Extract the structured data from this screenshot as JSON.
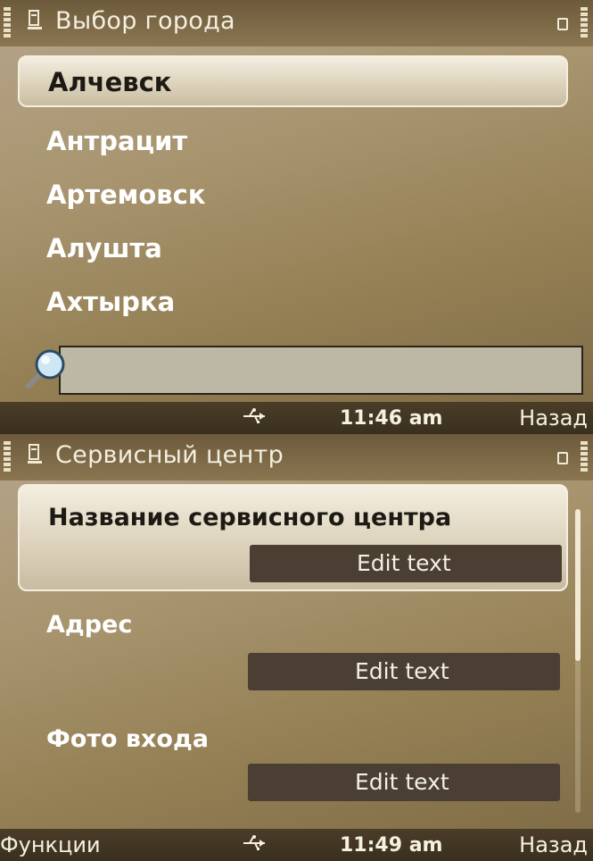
{
  "screen1": {
    "title": "Выбор города",
    "cities": [
      "Алчевск",
      "Антрацит",
      "Артемовск",
      "Алушта",
      "Ахтырка"
    ],
    "selected_index": 0,
    "search": {
      "value": ""
    },
    "softkeys": {
      "left": "",
      "right": "Назад"
    },
    "clock": "11:46 am"
  },
  "screen2": {
    "title": "Сервисный центр",
    "fields": [
      {
        "label": "Название сервисного центра",
        "value": "Edit text"
      },
      {
        "label": "Адрес",
        "value": "Edit text"
      },
      {
        "label": "Фото входа",
        "value": "Edit text"
      }
    ],
    "selected_index": 0,
    "softkeys": {
      "left": "Функции",
      "right": "Назад"
    },
    "clock": "11:49 am"
  },
  "colors": {
    "background": "#a8956f",
    "highlight": "#ddd3bd",
    "edit_field": "#4a3f32",
    "softkey_bar": "#3a2f1e",
    "text_light": "#ffffff",
    "text_dark": "#1d1a14"
  },
  "icons": {
    "signal": "signal-strength-icon",
    "battery": "battery-level-icon",
    "app": "phone-app-icon",
    "mode": "standby-mode-icon",
    "search": "magnifier-icon",
    "usb": "usb-connection-icon"
  }
}
